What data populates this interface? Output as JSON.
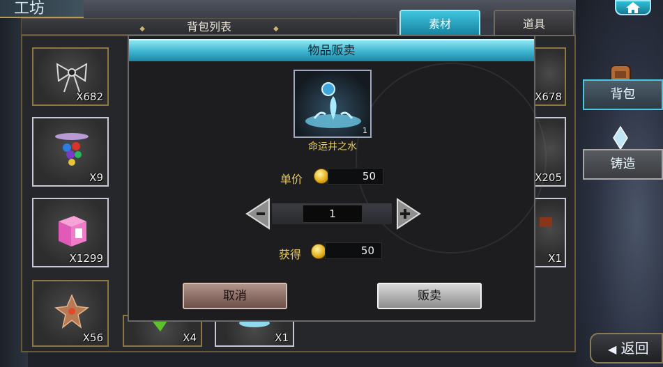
{
  "screen_title": "工坊",
  "list_header": "背包列表",
  "tabs": [
    {
      "label": "素材",
      "active": true
    },
    {
      "label": "道具",
      "active": false
    }
  ],
  "grid_items": [
    {
      "qty": "X682",
      "icon": "bow-icon"
    },
    {
      "qty": "X9",
      "icon": "jeweled-amulet-icon"
    },
    {
      "qty": "X1299",
      "icon": "pink-cube-icon"
    },
    {
      "qty": "X56",
      "icon": "ember-crystal-icon"
    },
    {
      "qty": "X4",
      "icon": "green-leaf-icon"
    },
    {
      "qty": "X1",
      "icon": "water-splash-icon"
    },
    {
      "qty": "X678",
      "icon": "item-icon"
    },
    {
      "qty": "X205",
      "icon": "item-icon"
    },
    {
      "qty": "X1",
      "icon": "red-gem-icon"
    }
  ],
  "side_nav": [
    {
      "label": "背包",
      "icon": "backpack-icon",
      "active": true
    },
    {
      "label": "铸造",
      "icon": "crystal-forge-icon",
      "active": false
    }
  ],
  "back_label": "返回",
  "dialog": {
    "title": "物品贩卖",
    "item_name": "命运井之水",
    "item_icon": "water-splash-icon",
    "item_count": "1",
    "unit_price_label": "单价",
    "unit_price": "50",
    "quantity": "1",
    "earn_label": "获得",
    "earn_value": "50",
    "cancel_label": "取消",
    "sell_label": "贩卖"
  },
  "colors": {
    "accent_cyan": "#3bb4cf",
    "gold_text": "#e8cc58",
    "panel_bg": "#1d1d1f"
  }
}
